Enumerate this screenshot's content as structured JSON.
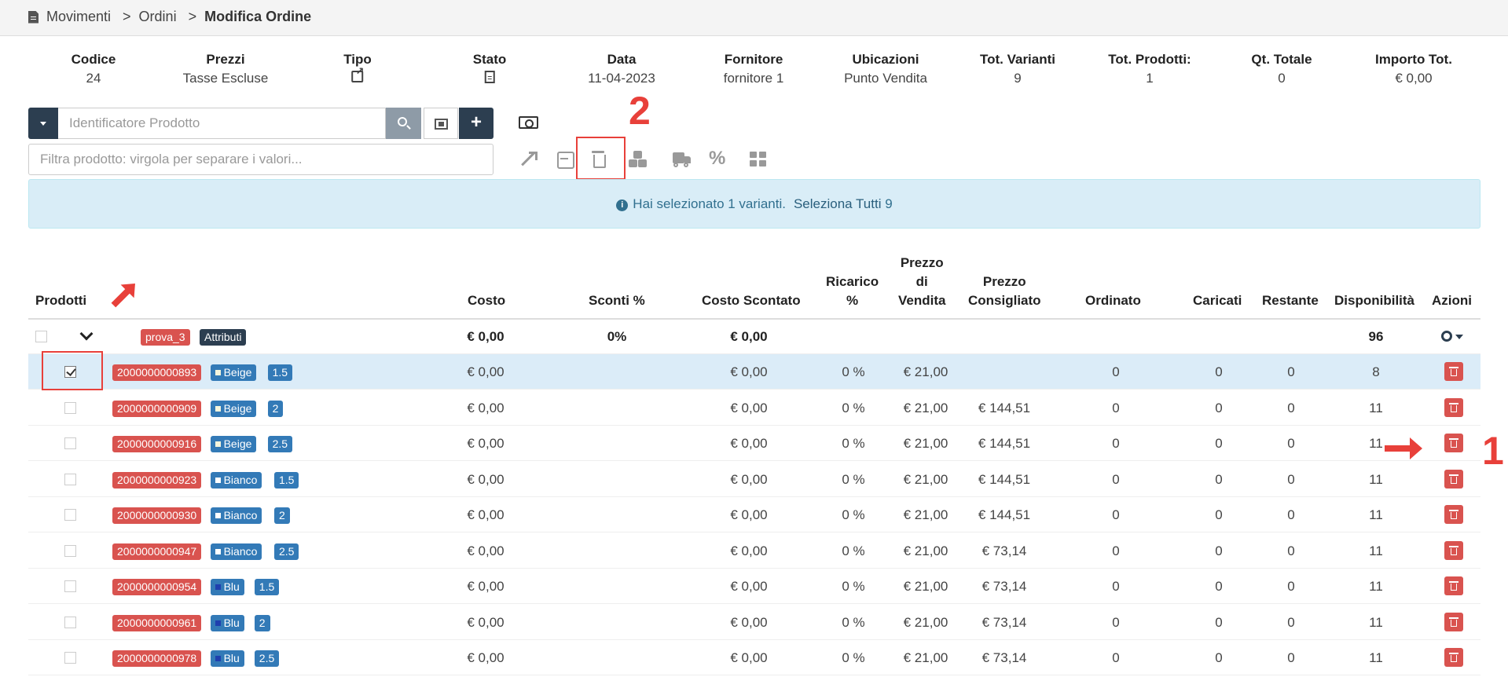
{
  "breadcrumb": {
    "items": [
      "Movimenti",
      "Ordini"
    ],
    "separator": ">",
    "current": "Modifica Ordine"
  },
  "summary": {
    "codice_h": "Codice",
    "codice_v": "24",
    "prezzi_h": "Prezzi",
    "prezzi_v": "Tasse Escluse",
    "tipo_h": "Tipo",
    "stato_h": "Stato",
    "data_h": "Data",
    "data_v": "11-04-2023",
    "fornitore_h": "Fornitore",
    "fornitore_v": "fornitore 1",
    "ubicazioni_h": "Ubicazioni",
    "ubicazioni_v": "Punto Vendita",
    "totvar_h": "Tot. Varianti",
    "totvar_v": "9",
    "totprod_h": "Tot. Prodotti:",
    "totprod_v": "1",
    "qt_h": "Qt. Totale",
    "qt_v": "0",
    "importo_h": "Importo Tot.",
    "importo_v": "€ 0,00"
  },
  "search": {
    "placeholder": "Identificatore Prodotto",
    "filter_placeholder": "Filtra prodotto: virgola per separare i valori..."
  },
  "icons": [
    "expand-icon",
    "collapse-icon",
    "trash-icon",
    "cubes-icon",
    "truck-icon",
    "percent-icon",
    "grid-icon",
    "money-icon"
  ],
  "toolbar": {
    "percent_glyph": "%"
  },
  "annotations": {
    "step1": "1",
    "step2": "2",
    "color": "#e8403a"
  },
  "alert": {
    "text": "Hai selezionato 1 varianti.",
    "select_all": "Seleziona Tutti",
    "select_all_count": "9"
  },
  "table": {
    "headers": {
      "prodotti": "Prodotti",
      "costo": "Costo",
      "sconti": "Sconti %",
      "costo_scontato": "Costo Scontato",
      "ricarico_1": "Ricarico",
      "ricarico_2": "%",
      "prezzo_vendita_1": "Prezzo",
      "prezzo_vendita_2": "di",
      "prezzo_vendita_3": "Vendita",
      "prezzo_consigliato_1": "Prezzo",
      "prezzo_consigliato_2": "Consigliato",
      "ordinato": "Ordinato",
      "caricati": "Caricati",
      "restante": "Restante",
      "disponibilita": "Disponibilità",
      "azioni": "Azioni"
    },
    "group": {
      "name": "prova_3",
      "attr_label": "Attributi",
      "costo": "€ 0,00",
      "sconti": "0%",
      "costo_scontato": "€ 0,00",
      "disponibilita": "96"
    },
    "rows": [
      {
        "code": "2000000000893",
        "color": "Beige",
        "swatch": "#f5f5dc",
        "size": "1.5",
        "costo": "€ 0,00",
        "costo_scontato": "€ 0,00",
        "ricarico": "0 %",
        "prezzo_vendita": "€ 21,00",
        "prezzo_consigliato": "",
        "ordinato": "0",
        "caricati": "0",
        "restante": "0",
        "disponibilita": "8",
        "checked": true
      },
      {
        "code": "2000000000909",
        "color": "Beige",
        "swatch": "#f5f5dc",
        "size": "2",
        "costo": "€ 0,00",
        "costo_scontato": "€ 0,00",
        "ricarico": "0 %",
        "prezzo_vendita": "€ 21,00",
        "prezzo_consigliato": "€ 144,51",
        "ordinato": "0",
        "caricati": "0",
        "restante": "0",
        "disponibilita": "11",
        "checked": false
      },
      {
        "code": "2000000000916",
        "color": "Beige",
        "swatch": "#f5f5dc",
        "size": "2.5",
        "costo": "€ 0,00",
        "costo_scontato": "€ 0,00",
        "ricarico": "0 %",
        "prezzo_vendita": "€ 21,00",
        "prezzo_consigliato": "€ 144,51",
        "ordinato": "0",
        "caricati": "0",
        "restante": "0",
        "disponibilita": "11",
        "checked": false
      },
      {
        "code": "2000000000923",
        "color": "Bianco",
        "swatch": "#ffffff",
        "size": "1.5",
        "costo": "€ 0,00",
        "costo_scontato": "€ 0,00",
        "ricarico": "0 %",
        "prezzo_vendita": "€ 21,00",
        "prezzo_consigliato": "€ 144,51",
        "ordinato": "0",
        "caricati": "0",
        "restante": "0",
        "disponibilita": "11",
        "checked": false
      },
      {
        "code": "2000000000930",
        "color": "Bianco",
        "swatch": "#ffffff",
        "size": "2",
        "costo": "€ 0,00",
        "costo_scontato": "€ 0,00",
        "ricarico": "0 %",
        "prezzo_vendita": "€ 21,00",
        "prezzo_consigliato": "€ 144,51",
        "ordinato": "0",
        "caricati": "0",
        "restante": "0",
        "disponibilita": "11",
        "checked": false
      },
      {
        "code": "2000000000947",
        "color": "Bianco",
        "swatch": "#ffffff",
        "size": "2.5",
        "costo": "€ 0,00",
        "costo_scontato": "€ 0,00",
        "ricarico": "0 %",
        "prezzo_vendita": "€ 21,00",
        "prezzo_consigliato": "€ 73,14",
        "ordinato": "0",
        "caricati": "0",
        "restante": "0",
        "disponibilita": "11",
        "checked": false
      },
      {
        "code": "2000000000954",
        "color": "Blu",
        "swatch": "#1f3fae",
        "size": "1.5",
        "costo": "€ 0,00",
        "costo_scontato": "€ 0,00",
        "ricarico": "0 %",
        "prezzo_vendita": "€ 21,00",
        "prezzo_consigliato": "€ 73,14",
        "ordinato": "0",
        "caricati": "0",
        "restante": "0",
        "disponibilita": "11",
        "checked": false
      },
      {
        "code": "2000000000961",
        "color": "Blu",
        "swatch": "#1f3fae",
        "size": "2",
        "costo": "€ 0,00",
        "costo_scontato": "€ 0,00",
        "ricarico": "0 %",
        "prezzo_vendita": "€ 21,00",
        "prezzo_consigliato": "€ 73,14",
        "ordinato": "0",
        "caricati": "0",
        "restante": "0",
        "disponibilita": "11",
        "checked": false
      },
      {
        "code": "2000000000978",
        "color": "Blu",
        "swatch": "#1f3fae",
        "size": "2.5",
        "costo": "€ 0,00",
        "costo_scontato": "€ 0,00",
        "ricarico": "0 %",
        "prezzo_vendita": "€ 21,00",
        "prezzo_consigliato": "€ 73,14",
        "ordinato": "0",
        "caricati": "0",
        "restante": "0",
        "disponibilita": "11",
        "checked": false
      }
    ]
  }
}
